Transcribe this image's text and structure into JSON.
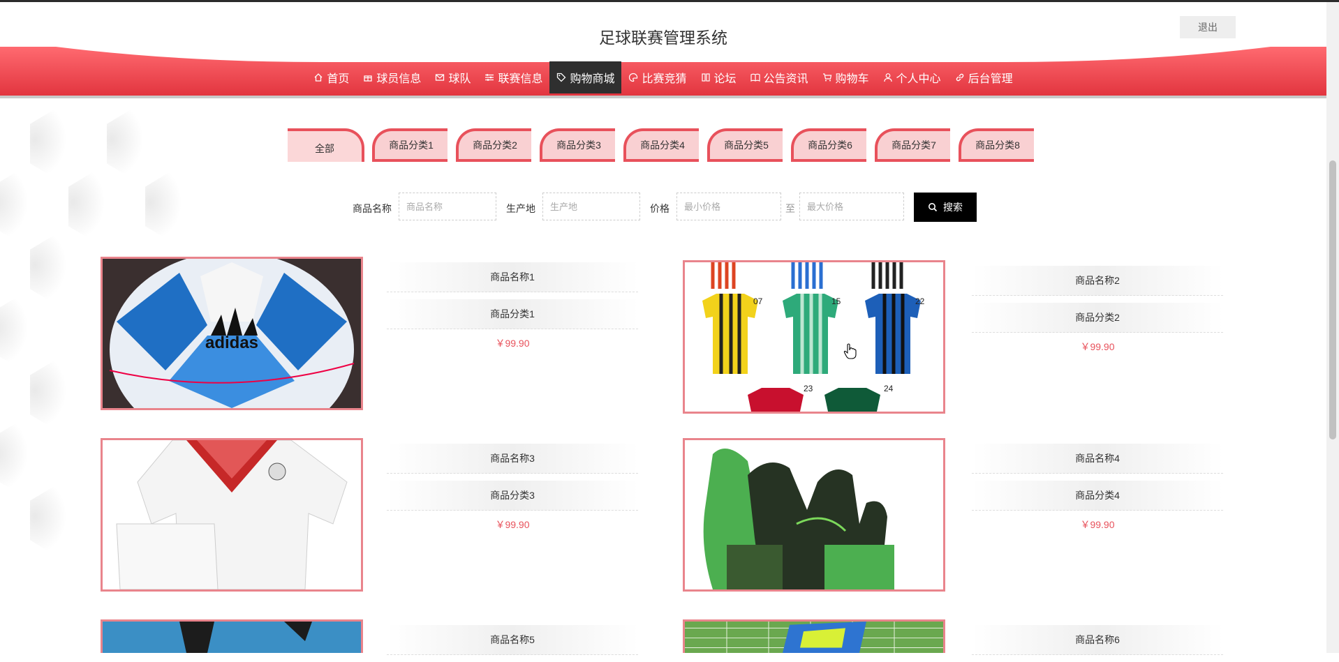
{
  "header": {
    "title": "足球联赛管理系统",
    "logout_label": "退出"
  },
  "nav": [
    {
      "label": "首页",
      "icon": "home-icon",
      "active": false
    },
    {
      "label": "球员信息",
      "icon": "gift-icon",
      "active": false
    },
    {
      "label": "球队",
      "icon": "mail-icon",
      "active": false
    },
    {
      "label": "联赛信息",
      "icon": "sliders-icon",
      "active": false
    },
    {
      "label": "购物商城",
      "icon": "tag-icon",
      "active": true
    },
    {
      "label": "比赛竞猜",
      "icon": "palette-icon",
      "active": false
    },
    {
      "label": "论坛",
      "icon": "forum-icon",
      "active": false
    },
    {
      "label": "公告资讯",
      "icon": "book-icon",
      "active": false
    },
    {
      "label": "购物车",
      "icon": "cart-icon",
      "active": false
    },
    {
      "label": "个人中心",
      "icon": "user-icon",
      "active": false
    },
    {
      "label": "后台管理",
      "icon": "link-icon",
      "active": false
    }
  ],
  "categories": [
    "全部",
    "商品分类1",
    "商品分类2",
    "商品分类3",
    "商品分类4",
    "商品分类5",
    "商品分类6",
    "商品分类7",
    "商品分类8"
  ],
  "search": {
    "name_label": "商品名称",
    "name_placeholder": "商品名称",
    "origin_label": "生产地",
    "origin_placeholder": "生产地",
    "price_label": "价格",
    "min_placeholder": "最小价格",
    "to": "至",
    "max_placeholder": "最大价格",
    "button_label": "搜索"
  },
  "products": [
    {
      "name": "商品名称1",
      "category": "商品分类1",
      "price": "￥99.90",
      "image": "soccer-ball"
    },
    {
      "name": "商品名称2",
      "category": "商品分类2",
      "price": "￥99.90",
      "image": "jerseys"
    },
    {
      "name": "商品名称3",
      "category": "商品分类3",
      "price": "￥99.90",
      "image": "kit"
    },
    {
      "name": "商品名称4",
      "category": "商品分类4",
      "price": "￥99.90",
      "image": "gloves"
    },
    {
      "name": "商品名称5",
      "category": "",
      "price": "",
      "image": "player"
    },
    {
      "name": "商品名称6",
      "category": "",
      "price": "",
      "image": "boots"
    }
  ],
  "colors": {
    "accent": "#e8515b",
    "nav_active": "#2f2f2f",
    "search_button": "#000000"
  }
}
